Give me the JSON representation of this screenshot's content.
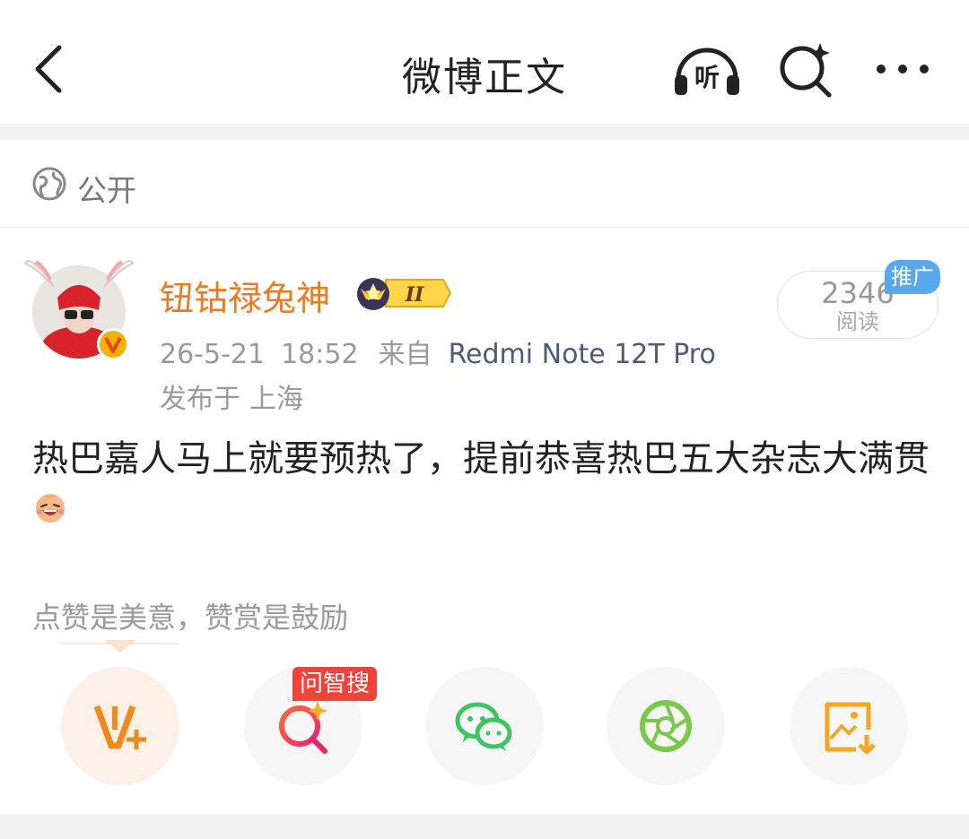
{
  "nav": {
    "title": "微博正文",
    "listen_label": "听"
  },
  "privacy": {
    "label": "公开"
  },
  "post": {
    "username": "钮钴禄兔神",
    "badge_level": "II",
    "date": "26-5-21",
    "time": "18:52",
    "source_prefix": "来自",
    "device": "Redmi Note 12T Pro",
    "location_prefix": "发布于",
    "location": "上海",
    "reads_count": "2346",
    "reads_label": "阅读",
    "promo_tag": "推广",
    "text": "热巴嘉人马上就要预热了，提前恭喜热巴五大杂志大满贯"
  },
  "tip": "点赞是美意，赞赏是鼓励",
  "actions": {
    "search_tag": "问智搜"
  },
  "colors": {
    "username": "#eb7a20",
    "device": "#4d5a78",
    "promo": "#5aa8ec",
    "tag": "#f0433c",
    "wechat": "#3dc563",
    "moments": "#79c94a",
    "save": "#f5a623"
  },
  "icons": [
    "back-arrow-icon",
    "listen-icon",
    "smart-search-icon",
    "more-icon",
    "globe-icon",
    "verified-icon",
    "crown-badge-icon",
    "laugh-emoji-icon",
    "reward-icon",
    "ai-search-icon",
    "wechat-icon",
    "moments-icon",
    "save-image-icon"
  ]
}
